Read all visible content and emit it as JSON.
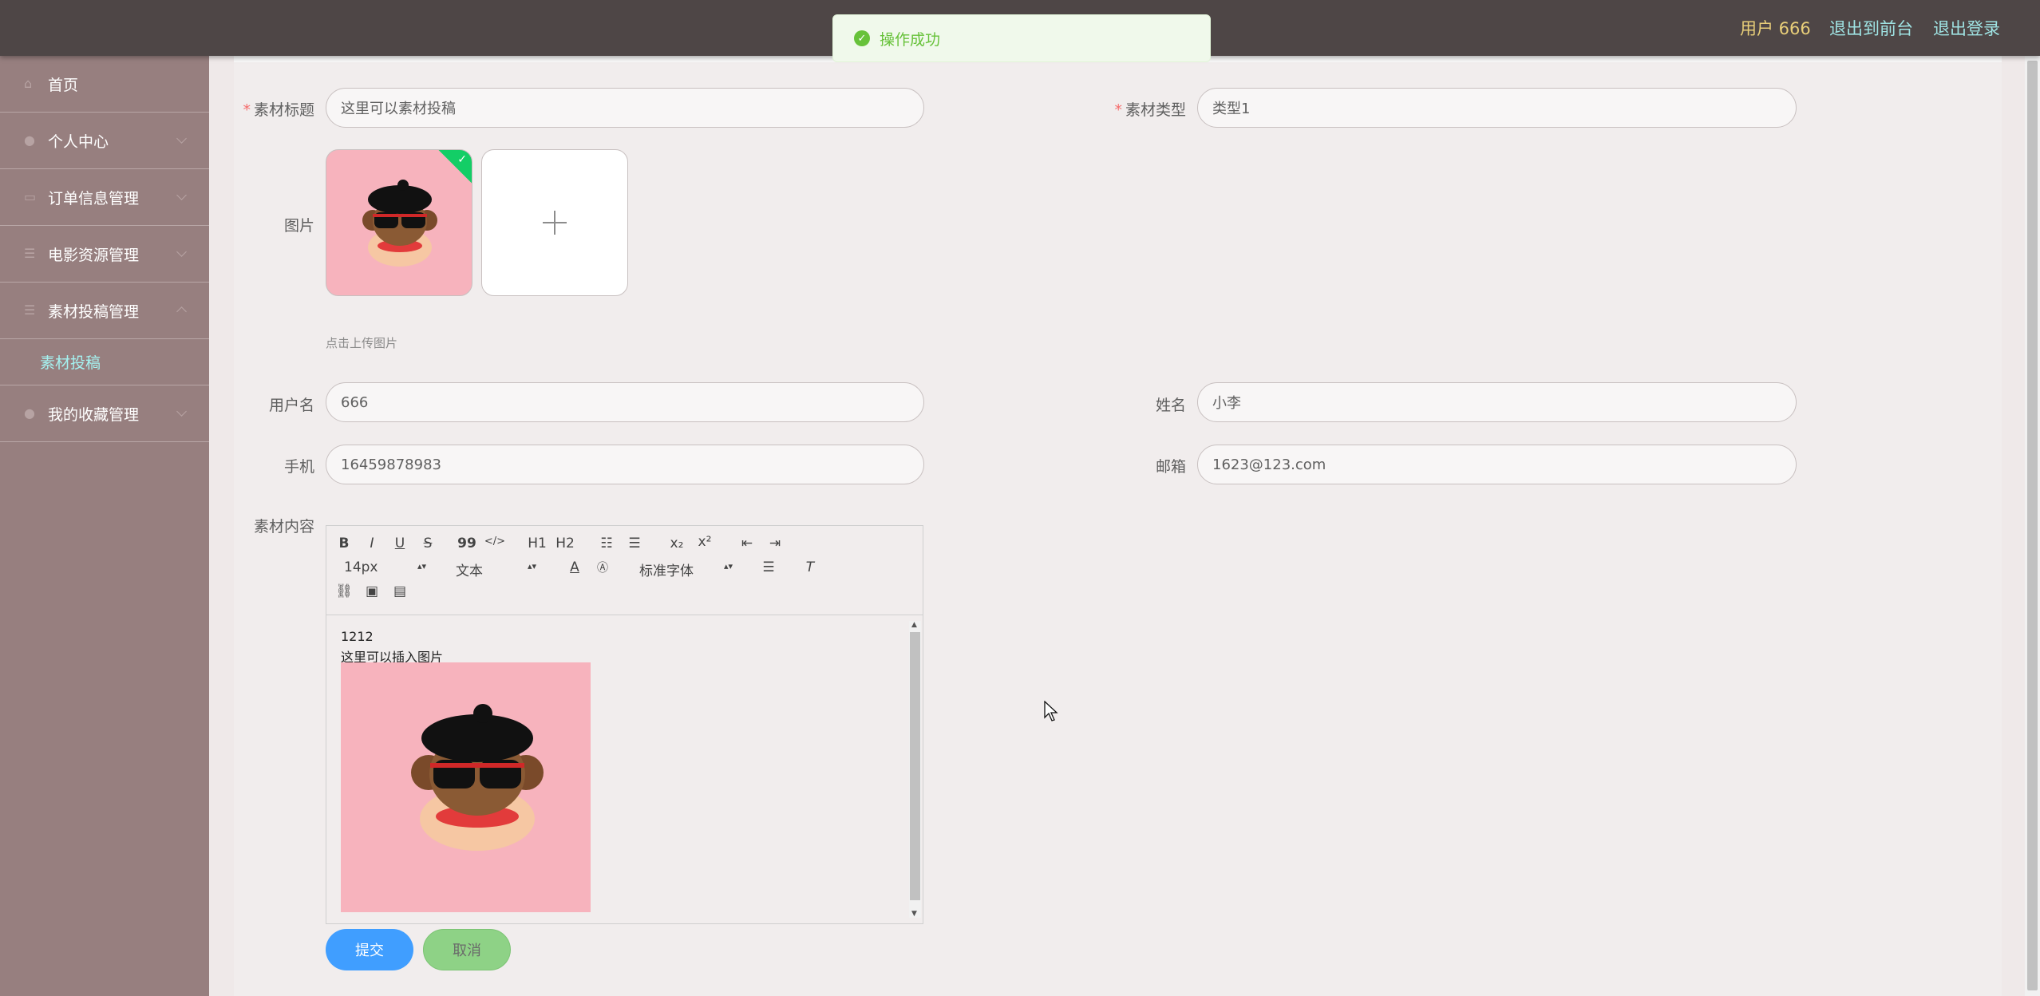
{
  "header": {
    "user_label": "用户 666",
    "links": [
      "退出到前台",
      "退出登录"
    ]
  },
  "toast": {
    "message": "操作成功",
    "icon": "success-check-icon"
  },
  "sidebar": {
    "items": [
      {
        "label": "首页",
        "icon": "home-icon"
      },
      {
        "label": "个人中心",
        "icon": "user-icon"
      },
      {
        "label": "订单信息管理",
        "icon": "order-icon"
      },
      {
        "label": "电影资源管理",
        "icon": "list-icon"
      },
      {
        "label": "素材投稿管理",
        "icon": "list-icon"
      },
      {
        "label": "我的收藏管理",
        "icon": "favorite-icon"
      }
    ],
    "submenu_active": "素材投稿"
  },
  "form": {
    "title_label": "素材标题",
    "title_value": "这里可以素材投稿",
    "type_label": "素材类型",
    "type_value": "类型1",
    "image_label": "图片",
    "upload_tip": "点击上传图片",
    "username_label": "用户名",
    "username_value": "666",
    "name_label": "姓名",
    "name_value": "小李",
    "phone_label": "手机",
    "phone_value": "16459878983",
    "email_label": "邮箱",
    "email_value": "1623@123.com",
    "content_label": "素材内容"
  },
  "editor": {
    "toolbar": {
      "row1": [
        "B",
        "I",
        "U",
        "S",
        "99",
        "</>",
        "H1",
        "H2",
        "ol",
        "ul",
        "x2",
        "x2",
        "outdent",
        "indent"
      ],
      "font_size": "14px",
      "text_style": "文本",
      "font_family": "标准字体"
    },
    "content_lines": [
      "1212",
      "这里可以插入图片"
    ]
  },
  "buttons": {
    "submit": "提交",
    "cancel": "取消"
  },
  "colors": {
    "topbar": "#4e4646",
    "sidebar": "#977f7f",
    "accent_blue": "#409eff",
    "cancel_green": "#8ed286",
    "user_gold": "#e9cf79",
    "link_cyan": "#9fe3e3",
    "active_submenu": "#a5f2f0"
  }
}
